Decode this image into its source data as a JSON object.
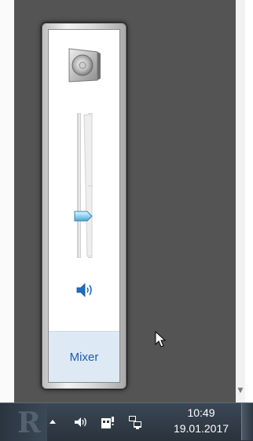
{
  "volume_flyout": {
    "device_icon": "speaker-device-icon",
    "volume_level_percent": 27,
    "mute_toggle_icon": "speaker-volume-icon",
    "mixer_label": "Mixer"
  },
  "taskbar": {
    "tray_icons": [
      "show-hidden-icons-arrow",
      "volume-icon",
      "action-center-icon",
      "network-icon"
    ],
    "clock": {
      "time": "10:49",
      "date": "19.01.2017"
    }
  },
  "colors": {
    "mixer_link": "#1c5bb0",
    "mixer_bar": "#dde9f5",
    "thumb": "#8fd3f0"
  }
}
